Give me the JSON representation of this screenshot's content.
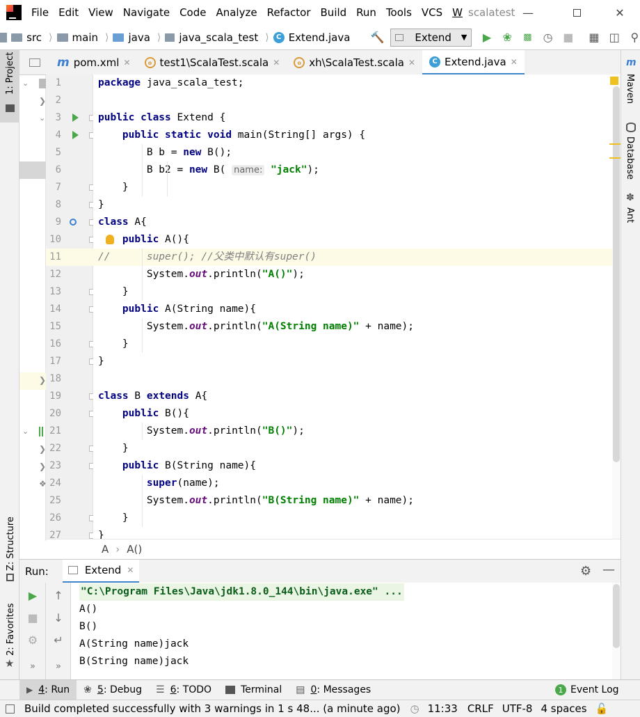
{
  "menubar": {
    "items": [
      "File",
      "Edit",
      "View",
      "Navigate",
      "Code",
      "Analyze",
      "Refactor",
      "Build",
      "Run",
      "Tools",
      "VCS",
      "W"
    ],
    "project_title": "scalatest"
  },
  "navbar": {
    "crumbs": [
      "src",
      "main",
      "java",
      "java_scala_test",
      "Extend.java"
    ],
    "run_config": "Extend"
  },
  "tabs": [
    {
      "label": "pom.xml",
      "icon": "maven-icon"
    },
    {
      "label": "test1\\ScalaTest.scala",
      "icon": "scala-object-icon"
    },
    {
      "label": "xh\\ScalaTest.scala",
      "icon": "scala-object-icon"
    },
    {
      "label": "Extend.java",
      "icon": "java-class-icon",
      "active": true
    }
  ],
  "left_tools": {
    "project": "1: Project",
    "structure": "Z: Structure",
    "favorites": "2: Favorites"
  },
  "right_tools": {
    "maven": "Maven",
    "database": "Database",
    "ant": "Ant"
  },
  "editor": {
    "code_lines": [
      [
        {
          "t": "package",
          "c": "kw"
        },
        {
          "t": " java_scala_test;"
        }
      ],
      [],
      [
        {
          "t": "public class",
          "c": "kw"
        },
        {
          "t": " Extend {"
        }
      ],
      [
        {
          "t": "    "
        },
        {
          "t": "public static void",
          "c": "kw"
        },
        {
          "t": " main(String[] args) {"
        }
      ],
      [
        {
          "t": "        B b = "
        },
        {
          "t": "new",
          "c": "kw"
        },
        {
          "t": " B();"
        }
      ],
      [
        {
          "t": "        B b2 = "
        },
        {
          "t": "new",
          "c": "kw"
        },
        {
          "t": " B( "
        },
        {
          "t": "name:",
          "c": "hint"
        },
        {
          "t": " "
        },
        {
          "t": "\"jack\"",
          "c": "str"
        },
        {
          "t": ");"
        }
      ],
      [
        {
          "t": "    }"
        }
      ],
      [
        {
          "t": "}"
        }
      ],
      [
        {
          "t": "class",
          "c": "kw"
        },
        {
          "t": " A{"
        }
      ],
      [
        {
          "t": "    "
        },
        {
          "t": "public",
          "c": "kw"
        },
        {
          "t": " A(){"
        }
      ],
      [
        {
          "t": "//      super(); //父类中默认有super()",
          "c": "cmt"
        }
      ],
      [
        {
          "t": "        System."
        },
        {
          "t": "out",
          "c": "static"
        },
        {
          "t": ".println("
        },
        {
          "t": "\"A()\"",
          "c": "str"
        },
        {
          "t": ");"
        }
      ],
      [
        {
          "t": "    }"
        }
      ],
      [
        {
          "t": "    "
        },
        {
          "t": "public",
          "c": "kw"
        },
        {
          "t": " A(String name){"
        }
      ],
      [
        {
          "t": "        System."
        },
        {
          "t": "out",
          "c": "static"
        },
        {
          "t": ".println("
        },
        {
          "t": "\"A(String name)\"",
          "c": "str"
        },
        {
          "t": " + name);"
        }
      ],
      [
        {
          "t": "    }"
        }
      ],
      [
        {
          "t": "}"
        }
      ],
      [],
      [
        {
          "t": "class",
          "c": "kw"
        },
        {
          "t": " B "
        },
        {
          "t": "extends",
          "c": "kw"
        },
        {
          "t": " A{"
        }
      ],
      [
        {
          "t": "    "
        },
        {
          "t": "public",
          "c": "kw"
        },
        {
          "t": " B(){"
        }
      ],
      [
        {
          "t": "        System."
        },
        {
          "t": "out",
          "c": "static"
        },
        {
          "t": ".println("
        },
        {
          "t": "\"B()\"",
          "c": "str"
        },
        {
          "t": ");"
        }
      ],
      [
        {
          "t": "    }"
        }
      ],
      [
        {
          "t": "    "
        },
        {
          "t": "public",
          "c": "kw"
        },
        {
          "t": " B(String name){"
        }
      ],
      [
        {
          "t": "        "
        },
        {
          "t": "super",
          "c": "kw"
        },
        {
          "t": "(name);"
        }
      ],
      [
        {
          "t": "        System."
        },
        {
          "t": "out",
          "c": "static"
        },
        {
          "t": ".println("
        },
        {
          "t": "\"B(String name)\"",
          "c": "str"
        },
        {
          "t": " + name);"
        }
      ],
      [
        {
          "t": "    }"
        }
      ],
      [
        {
          "t": "}"
        }
      ]
    ],
    "highlighted_line": 11,
    "breadcrumb": [
      "A",
      "A()"
    ]
  },
  "run_panel": {
    "label": "Run:",
    "tab": "Extend",
    "output": [
      "\"C:\\Program Files\\Java\\jdk1.8.0_144\\bin\\java.exe\" ...",
      "A()",
      "B()",
      "A(String name)jack",
      "B(String name)jack"
    ]
  },
  "bottom_tools": [
    {
      "key": "4",
      "label": ": Run",
      "active": true,
      "icon": "run-icon"
    },
    {
      "key": "5",
      "label": ": Debug",
      "icon": "debug-icon"
    },
    {
      "key": "6",
      "label": ": TODO",
      "icon": "todo-icon"
    },
    {
      "key": "",
      "label": "Terminal",
      "icon": "terminal-icon"
    },
    {
      "key": "0",
      "label": ": Messages",
      "icon": "messages-icon"
    }
  ],
  "event_log": {
    "count": "1",
    "label": "Event Log"
  },
  "status": {
    "message": "Build completed successfully with 3 warnings in 1 s 48... (a minute ago)",
    "position": "11:33",
    "line_sep": "CRLF",
    "encoding": "UTF-8",
    "indent": "4 spaces"
  },
  "colors": {
    "accent": "#4083c9",
    "keyword": "#000080",
    "string": "#008000",
    "run_green": "#4aa84a"
  }
}
